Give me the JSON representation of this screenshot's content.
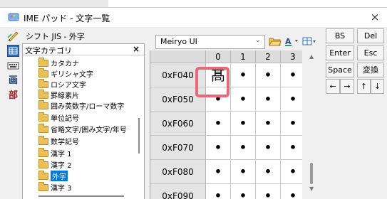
{
  "window": {
    "title": "IME パッド - 文字一覧",
    "close_glyph": "×"
  },
  "sidebar": {
    "icons": [
      "handwriting-icon",
      "char-list-icon",
      "soft-keyboard-icon",
      "stroke-count-icon",
      "radical-icon"
    ],
    "stroke_label": "画",
    "radical_label": "部"
  },
  "kind": {
    "label": "シフト JIS - 外字"
  },
  "tree": {
    "header": "文字カテゴリ",
    "close_glyph": "×",
    "items": [
      {
        "label": "カタカナ"
      },
      {
        "label": "ギリシャ文字"
      },
      {
        "label": "ロシア文字"
      },
      {
        "label": "罫線素片"
      },
      {
        "label": "囲み英数字/ローマ数字"
      },
      {
        "label": "単位記号"
      },
      {
        "label": "省略文字/囲み文字/年号"
      },
      {
        "label": "数学記号"
      },
      {
        "label": "漢字 1"
      },
      {
        "label": "漢字 2"
      },
      {
        "label": "外字",
        "selected": true
      },
      {
        "label": "漢字 3"
      }
    ]
  },
  "toolbar": {
    "font_value": "Meiryo UI",
    "dropdown_glyph": "⌄"
  },
  "grid": {
    "columns": [
      "0",
      "1",
      "2",
      "3"
    ],
    "rows": [
      {
        "code": "0xF040",
        "cells": [
          "髙",
          "•",
          "•",
          "•"
        ]
      },
      {
        "code": "0xF050",
        "cells": [
          "•",
          "•",
          "•",
          "•"
        ]
      },
      {
        "code": "0xF060",
        "cells": [
          "•",
          "•",
          "•",
          "•"
        ]
      },
      {
        "code": "0xF070",
        "cells": [
          "•",
          "•",
          "•",
          "•"
        ]
      },
      {
        "code": "0xF080",
        "cells": [
          "•",
          "•",
          "•",
          "•"
        ]
      },
      {
        "code": "0xF090",
        "cells": [
          "•",
          "•",
          "•",
          "•"
        ]
      }
    ]
  },
  "keys": {
    "bs": "BS",
    "del": "Del",
    "enter": "Enter",
    "esc": "Esc",
    "space": "Space",
    "convert": "変換",
    "left": "←",
    "right": "→",
    "up": "↑",
    "down": "↓"
  },
  "colors": {
    "accent": "#0078d7",
    "highlight": "#e86a78",
    "folder": "#e8c15a"
  }
}
